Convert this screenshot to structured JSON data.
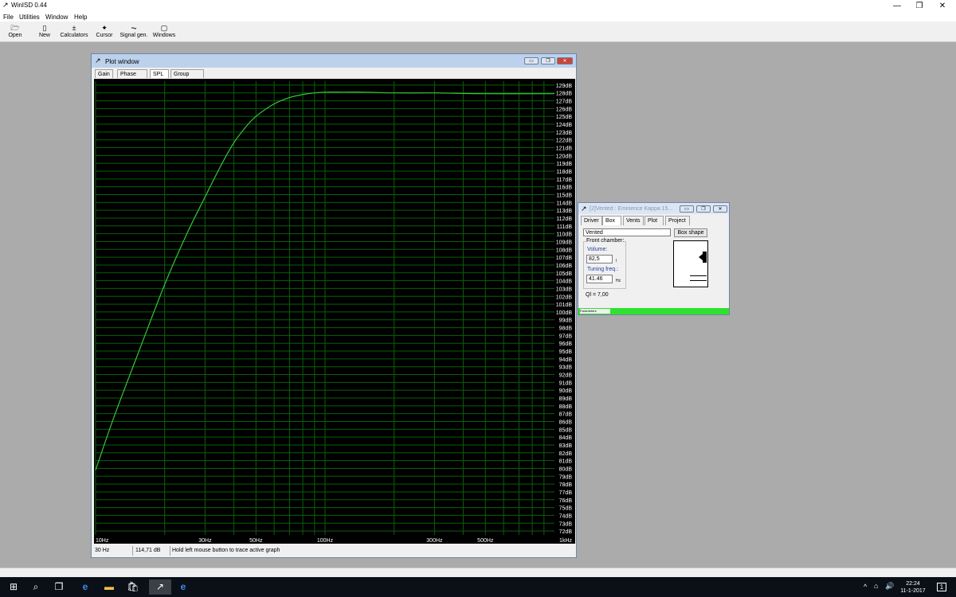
{
  "app": {
    "title": "WinISD 0.44",
    "icon": "winisd-app-icon",
    "controls": {
      "minimize": "—",
      "restore": "❐",
      "close": "✕"
    }
  },
  "menubar": {
    "items": [
      "File",
      "Utilities",
      "Window",
      "Help"
    ]
  },
  "toolbar": {
    "items": [
      {
        "label": "Open",
        "icon": "open-folder-icon",
        "glyph": "🗁"
      },
      {
        "label": "New",
        "icon": "new-document-icon",
        "glyph": "▯"
      },
      {
        "label": "Calculators",
        "icon": "calculator-icon",
        "glyph": "±"
      },
      {
        "label": "Cursor",
        "icon": "cursor-icon",
        "glyph": "✦"
      },
      {
        "label": "Signal gen.",
        "icon": "signal-generator-icon",
        "glyph": "⏦"
      },
      {
        "label": "Windows",
        "icon": "windows-icon",
        "glyph": "▢"
      }
    ]
  },
  "plot_window": {
    "title": "Plot window",
    "tabs": [
      {
        "label": "Gain",
        "active": false
      },
      {
        "label": "Phase plot",
        "active": false
      },
      {
        "label": "SPL",
        "active": true
      },
      {
        "label": "Group delay",
        "active": false
      }
    ],
    "status": {
      "frequency": "30 Hz",
      "level": "114,71 dB",
      "hint": "Hold left mouse button to trace active graph"
    }
  },
  "chart_data": {
    "type": "line",
    "title": "",
    "xlabel": "",
    "ylabel": "",
    "x_scale": "log",
    "xlim": [
      10,
      1000
    ],
    "ylim": [
      71.5,
      129.5
    ],
    "x_ticks": [
      {
        "value": 10,
        "label": "10Hz"
      },
      {
        "value": 30,
        "label": "30Hz"
      },
      {
        "value": 50,
        "label": "50Hz"
      },
      {
        "value": 100,
        "label": "100Hz"
      },
      {
        "value": 300,
        "label": "300Hz"
      },
      {
        "value": 500,
        "label": "500Hz"
      },
      {
        "value": 1000,
        "label": "1kHz"
      }
    ],
    "y_ticks": [
      72,
      73,
      74,
      75,
      76,
      77,
      78,
      79,
      80,
      81,
      82,
      83,
      84,
      85,
      86,
      87,
      88,
      89,
      90,
      91,
      92,
      93,
      94,
      95,
      96,
      97,
      98,
      99,
      100,
      101,
      102,
      103,
      104,
      105,
      106,
      107,
      108,
      109,
      110,
      111,
      112,
      113,
      114,
      115,
      116,
      117,
      118,
      119,
      120,
      121,
      122,
      123,
      124,
      125,
      126,
      127,
      128,
      129
    ],
    "y_tick_suffix": "dB",
    "grid": true,
    "background": "#000000",
    "grid_color": "#0b5e0b",
    "series": [
      {
        "color": "#35c835",
        "x": [
          10,
          12,
          15,
          20,
          25,
          30,
          35,
          40,
          45,
          50,
          60,
          70,
          80,
          90,
          100,
          120,
          150,
          200,
          300,
          500,
          1000
        ],
        "y": [
          79.8,
          86.5,
          94.0,
          103.5,
          110.0,
          114.7,
          118.6,
          121.6,
          123.6,
          125.0,
          126.6,
          127.4,
          127.8,
          128.0,
          128.1,
          128.1,
          128.1,
          128.0,
          128.0,
          127.9,
          127.9
        ]
      }
    ]
  },
  "vented_window": {
    "title": "[2]Vented : Eminence Kappa 15...",
    "tabs": [
      {
        "label": "Driver",
        "active": false
      },
      {
        "label": "Box",
        "active": true
      },
      {
        "label": "Vents",
        "active": false
      },
      {
        "label": "Plot",
        "active": false
      },
      {
        "label": "Project",
        "active": false
      }
    ],
    "box_type": "Vented",
    "box_shape_button": "Box shape",
    "front_chamber_label": "Front chamber:",
    "volume_label": "Volume:",
    "volume_value": "82,5",
    "volume_unit": "l",
    "tuning_label": "Tuning freq.:",
    "tuning_value": "41.46",
    "tuning_unit": "Hz",
    "ql": "Ql = 7,00",
    "progress_label": "Parameters",
    "progress_fraction": 1.0,
    "progress_color": "#2ee22e"
  },
  "taskbar": {
    "icons": [
      {
        "name": "start-windows-icon",
        "glyph": "⊞"
      },
      {
        "name": "search-icon",
        "glyph": "⌕"
      },
      {
        "name": "task-view-icon",
        "glyph": "❒"
      },
      {
        "name": "edge-browser-icon",
        "glyph": "e"
      },
      {
        "name": "file-explorer-icon",
        "glyph": "▬"
      },
      {
        "name": "store-icon",
        "glyph": "🛍"
      },
      {
        "name": "winisd-taskbar-icon",
        "glyph": "↗"
      },
      {
        "name": "internet-explorer-icon",
        "glyph": "e"
      }
    ],
    "time": "22:24",
    "date": "11-1-2017",
    "notification_count": "1"
  }
}
